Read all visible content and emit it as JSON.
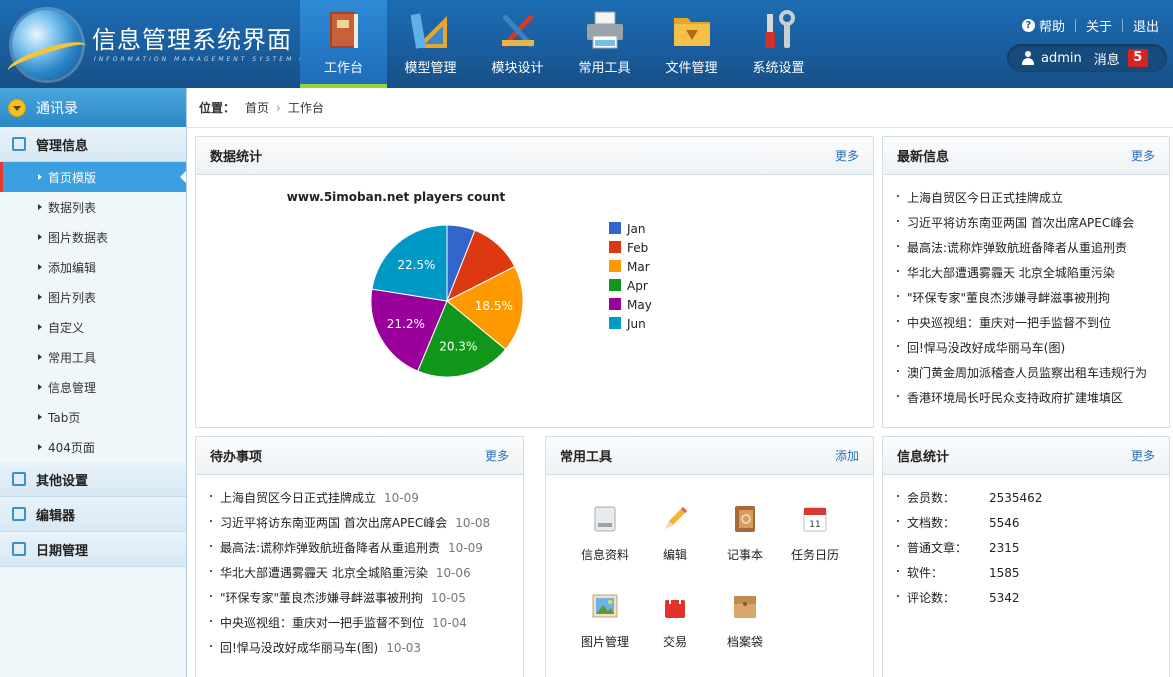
{
  "header": {
    "title": "信息管理系统界面",
    "subtitle": "INFORMATION MANAGEMENT SYSTEM GUI",
    "nav": [
      {
        "label": "工作台",
        "icon": "book-icon",
        "active": true
      },
      {
        "label": "模型管理",
        "icon": "ruler-triangle-icon",
        "active": false
      },
      {
        "label": "模块设计",
        "icon": "design-tools-icon",
        "active": false
      },
      {
        "label": "常用工具",
        "icon": "printer-icon",
        "active": false
      },
      {
        "label": "文件管理",
        "icon": "folder-icon",
        "active": false
      },
      {
        "label": "系统设置",
        "icon": "wrench-screwdriver-icon",
        "active": false
      }
    ],
    "links": {
      "help": "帮助",
      "about": "关于",
      "logout": "退出"
    },
    "user": {
      "name": "admin",
      "messages_label": "消息",
      "messages_count": "5"
    }
  },
  "sidebar": {
    "top": "通讯录",
    "groups": [
      {
        "label": "管理信息",
        "icon": "list-icon"
      },
      {
        "label": "其他设置",
        "icon": "chat-icon"
      },
      {
        "label": "编辑器",
        "icon": "edit-icon"
      },
      {
        "label": "日期管理",
        "icon": "calendar-icon"
      }
    ],
    "items": [
      "首页模版",
      "数据列表",
      "图片数据表",
      "添加编辑",
      "图片列表",
      "自定义",
      "常用工具",
      "信息管理",
      "Tab页",
      "404页面"
    ],
    "active_item": "首页模版"
  },
  "breadcrumb": {
    "label": "位置：",
    "items": [
      "首页",
      "工作台"
    ]
  },
  "stats_panel": {
    "title": "数据统计",
    "more": "更多"
  },
  "chart_data": {
    "type": "pie",
    "title": "www.5imoban.net players count",
    "categories": [
      "Jan",
      "Feb",
      "Mar",
      "Apr",
      "May",
      "Jun"
    ],
    "values": [
      6.0,
      11.5,
      18.5,
      20.3,
      21.2,
      22.5
    ],
    "labels": [
      "",
      "",
      "18.5%",
      "20.3%",
      "21.2%",
      "22.5%"
    ],
    "colors": [
      "#3366cc",
      "#dc3912",
      "#ff9900",
      "#109618",
      "#990099",
      "#0099c6"
    ],
    "legend": "right"
  },
  "news_panel": {
    "title": "最新信息",
    "more": "更多",
    "items": [
      "上海自贸区今日正式挂牌成立",
      "习近平将访东南亚两国 首次出席APEC峰会",
      "最高法:谎称炸弹致航班备降者从重追刑责",
      "华北大部遭遇雾霾天 北京全城陷重污染",
      "\"环保专家\"董良杰涉嫌寻衅滋事被刑拘",
      "中央巡视组：重庆对一把手监督不到位",
      "回!悍马没改好成华丽马车(图)",
      "澳门黄金周加派稽查人员监察出租车违规行为",
      "香港环境局长吁民众支持政府扩建堆填区"
    ]
  },
  "todo_panel": {
    "title": "待办事项",
    "more": "更多",
    "items": [
      {
        "text": "上海自贸区今日正式挂牌成立",
        "date": "10-09"
      },
      {
        "text": "习近平将访东南亚两国 首次出席APEC峰会",
        "date": "10-08"
      },
      {
        "text": "最高法:谎称炸弹致航班备降者从重追刑责",
        "date": "10-09"
      },
      {
        "text": "华北大部遭遇雾霾天 北京全城陷重污染",
        "date": "10-06"
      },
      {
        "text": "\"环保专家\"董良杰涉嫌寻衅滋事被刑拘",
        "date": "10-05"
      },
      {
        "text": "中央巡视组：重庆对一把手监督不到位",
        "date": "10-04"
      },
      {
        "text": "回!悍马没改好成华丽马车(图)",
        "date": "10-03"
      }
    ]
  },
  "tools_panel": {
    "title": "常用工具",
    "add": "添加",
    "items": [
      {
        "label": "信息资料",
        "icon": "drive-icon"
      },
      {
        "label": "编辑",
        "icon": "pencil-icon"
      },
      {
        "label": "记事本",
        "icon": "address-book-icon"
      },
      {
        "label": "任务日历",
        "icon": "calendar-page-icon"
      },
      {
        "label": "图片管理",
        "icon": "picture-icon"
      },
      {
        "label": "交易",
        "icon": "shopping-bag-icon"
      },
      {
        "label": "档案袋",
        "icon": "envelope-folder-icon"
      }
    ]
  },
  "info_panel": {
    "title": "信息统计",
    "more": "更多",
    "items": [
      {
        "label": "会员数：",
        "value": "2535462"
      },
      {
        "label": "文档数：",
        "value": "5546"
      },
      {
        "label": "普通文章：",
        "value": "2315"
      },
      {
        "label": "软件：",
        "value": "1585"
      },
      {
        "label": "评论数：",
        "value": "5342"
      }
    ]
  }
}
